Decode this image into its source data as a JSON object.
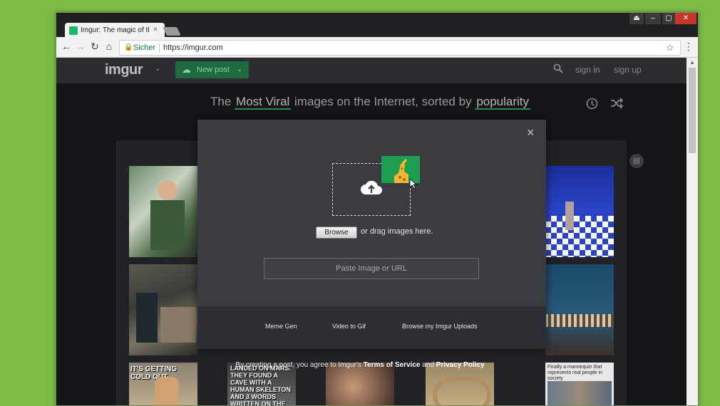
{
  "browser": {
    "tab_title": "Imgur: The magic of the",
    "tab_close": "×",
    "secure_label": "Sicher",
    "url": "https://imgur.com",
    "window_controls": [
      "⏏",
      "–",
      "▢",
      "✕"
    ]
  },
  "header": {
    "logo": "imgur",
    "new_post_label": "New post",
    "sign_in": "sign in",
    "sign_up": "sign up"
  },
  "hero": {
    "prefix": "The",
    "sort_type": "Most Viral",
    "middle": "images on the Internet, sorted by",
    "sort_order": "popularity"
  },
  "gallery": {
    "meme_captions": [
      "IT'S GETTING COLD OUT",
      "LANDED ON MARS. THEY FOUND A CAVE WITH A HUMAN SKELETON AND 3 WORDS WRITTEN ON THE WALL.",
      "Finally a mannequin that represents real people in society"
    ]
  },
  "modal": {
    "close_label": "×",
    "browse_label": "Browse",
    "drag_text": "or drag images here.",
    "paste_placeholder": "Paste Image or URL",
    "footer_links": [
      "Meme Gen",
      "Video to Gif",
      "Browse my Imgur Uploads"
    ]
  },
  "terms": {
    "prefix": "By creating a post, you agree to Imgur's",
    "terms_link": "Terms of Service",
    "and": "and",
    "privacy_link": "Privacy Policy"
  },
  "colors": {
    "desktop": "#7dbb46",
    "accent_green": "#1d6b3e",
    "modal_bg": "#3a3c42"
  },
  "icons": [
    "back-icon",
    "forward-icon",
    "reload-icon",
    "home-icon",
    "lock-icon",
    "star-icon",
    "menu-icon",
    "cloud-upload-icon",
    "search-icon",
    "clock-icon",
    "shuffle-icon",
    "chat-icon",
    "close-icon"
  ]
}
